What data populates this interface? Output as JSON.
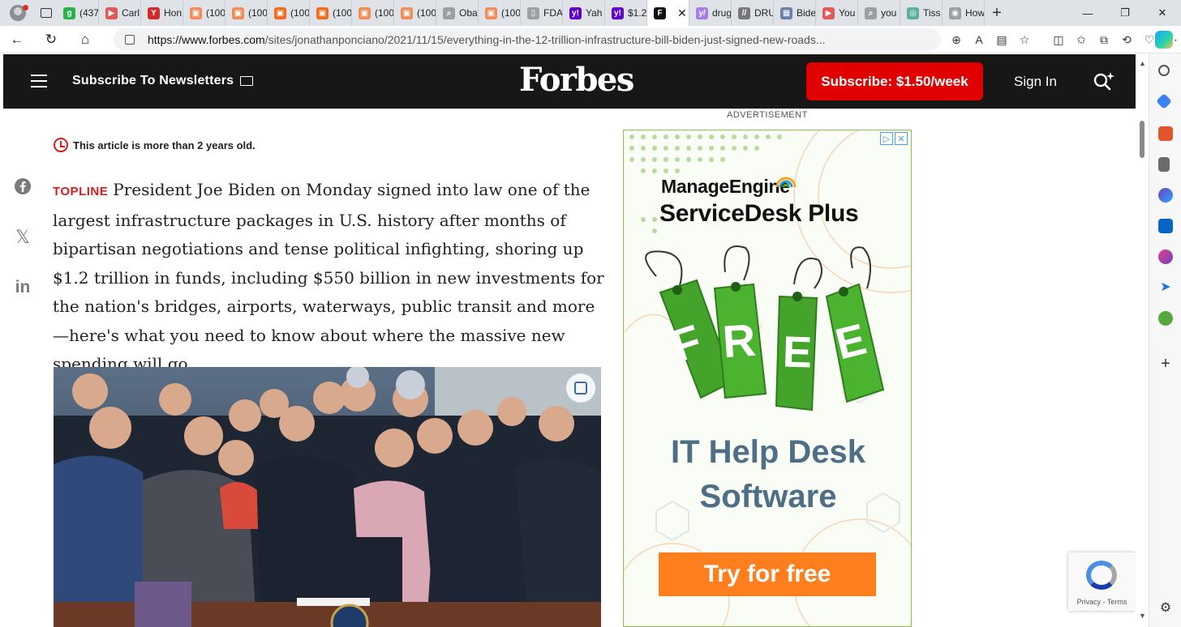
{
  "browser": {
    "tabs": [
      {
        "label": "(437",
        "color": "#2bb24c",
        "glyph": "g"
      },
      {
        "label": "Carl",
        "color": "#e05a5a",
        "glyph": "▶"
      },
      {
        "label": "Hon",
        "color": "#d42a2a",
        "glyph": "Y"
      },
      {
        "label": "(100",
        "color": "#f08c5a",
        "glyph": "▣"
      },
      {
        "label": "(100",
        "color": "#f08c5a",
        "glyph": "▣"
      },
      {
        "label": "(100",
        "color": "#f26a1b",
        "glyph": "▣"
      },
      {
        "label": "(100",
        "color": "#f26a1b",
        "glyph": "▣"
      },
      {
        "label": "(100",
        "color": "#f08c5a",
        "glyph": "▣"
      },
      {
        "label": "(100",
        "color": "#f08c5a",
        "glyph": "▣"
      },
      {
        "label": "Oba",
        "color": "#9aa0a6",
        "glyph": "⌕"
      },
      {
        "label": "(100",
        "color": "#f08c5a",
        "glyph": "▣"
      },
      {
        "label": "FDA",
        "color": "#9aa0a6",
        "glyph": "▯"
      },
      {
        "label": "Yah",
        "color": "#5f01d1",
        "glyph": "y!"
      },
      {
        "label": "$1.2",
        "color": "#5f01d1",
        "glyph": "y!"
      },
      {
        "label": "",
        "color": "#111111",
        "glyph": "F",
        "active": true
      },
      {
        "label": "drug",
        "color": "#a77de8",
        "glyph": "y/"
      },
      {
        "label": "DRU",
        "color": "#777777",
        "glyph": "//"
      },
      {
        "label": "Bide",
        "color": "#6b7fa6",
        "glyph": "▦"
      },
      {
        "label": "You",
        "color": "#e05a5a",
        "glyph": "▶"
      },
      {
        "label": "you",
        "color": "#9aa0a6",
        "glyph": "⌕"
      },
      {
        "label": "Tiss",
        "color": "#5ab0a0",
        "glyph": "◎"
      },
      {
        "label": "How",
        "color": "#9aa0a6",
        "glyph": "◉"
      }
    ],
    "url_host": "https://www.forbes.com",
    "url_path": "/sites/jonathanponciano/2021/11/15/everything-in-the-12-trillion-infrastructure-bill-biden-just-signed-new-roads..."
  },
  "header": {
    "newsletter_label": "Subscribe To Newsletters",
    "logo": "Forbes",
    "subscribe_label": "Subscribe: $1.50/week",
    "signin_label": "Sign In"
  },
  "article": {
    "age_notice": "This article is more than 2 years old.",
    "topline_label": "TOPLINE",
    "body": "President Joe Biden on Monday signed into law one of the largest infrastructure packages in U.S. history after months of bipartisan negotiations and tense political infighting, shoring up $1.2 trillion in funds, including $550 billion in new investments for the nation's bridges, airports, waterways, public transit and more—here's what you need to know about where the massive new spending will go."
  },
  "ad": {
    "label": "ADVERTISEMENT",
    "brand": "ManageEngine",
    "product": "ServiceDesk Plus",
    "tag_letters": [
      "F",
      "R",
      "E",
      "E"
    ],
    "headline_line1": "IT Help Desk",
    "headline_line2": "Software",
    "cta": "Try for free"
  },
  "recaptcha": {
    "links": "Privacy - Terms"
  },
  "colors": {
    "forbes_bg": "#181716",
    "subscribe_red": "#e00000",
    "topline_red": "#d91d1d",
    "ad_green": "#43a32b",
    "ad_orange": "#ff7f1e"
  }
}
